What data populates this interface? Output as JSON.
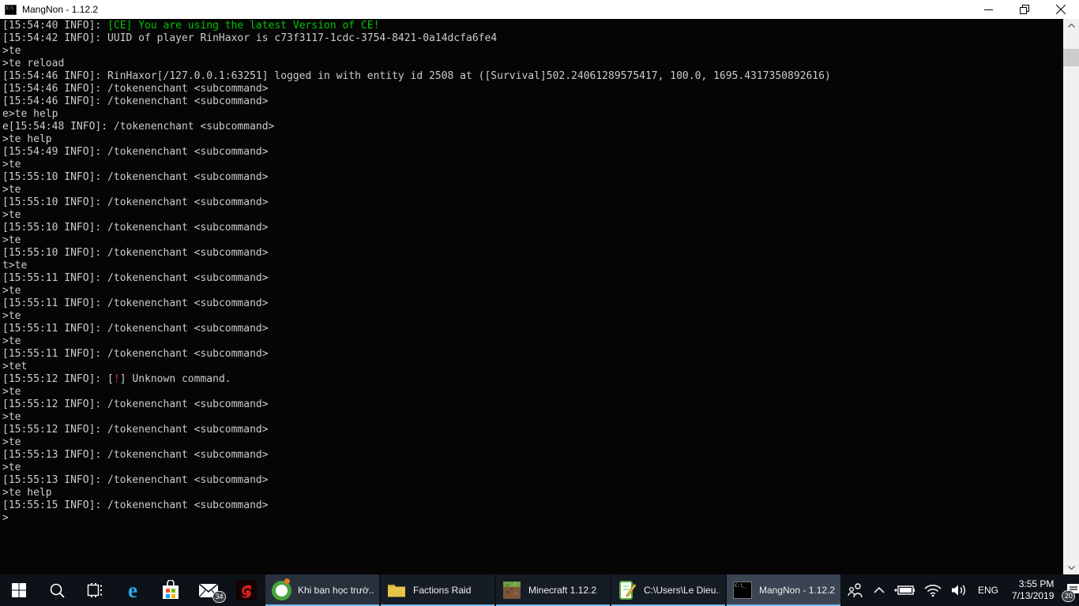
{
  "window": {
    "title": "MangNon - 1.12.2"
  },
  "console": {
    "lines": [
      {
        "segments": [
          {
            "t": "[15:54:40 INFO]: ",
            "c": "default"
          },
          {
            "t": "[CE] You are using the latest Version of CE!",
            "c": "green"
          }
        ]
      },
      {
        "segments": [
          {
            "t": "[15:54:42 INFO]: UUID of player RinHaxor is c73f3117-1cdc-3754-8421-0a14dcfa6fe4",
            "c": "default"
          }
        ]
      },
      {
        "segments": [
          {
            "t": ">te",
            "c": "default"
          }
        ]
      },
      {
        "segments": [
          {
            "t": ">te reload",
            "c": "default"
          }
        ]
      },
      {
        "segments": [
          {
            "t": "[15:54:46 INFO]: RinHaxor[/127.0.0.1:63251] logged in with entity id 2508 at ([Survival]502.24061289575417, 100.0, 1695.4317350892616)",
            "c": "default"
          }
        ]
      },
      {
        "segments": [
          {
            "t": "[15:54:46 INFO]: /tokenenchant <subcommand>",
            "c": "default"
          }
        ]
      },
      {
        "segments": [
          {
            "t": "[15:54:46 INFO]: /tokenenchant <subcommand>",
            "c": "default"
          }
        ]
      },
      {
        "segments": [
          {
            "t": "e>te help",
            "c": "default"
          }
        ]
      },
      {
        "segments": [
          {
            "t": "e[15:54:48 INFO]: /tokenenchant <subcommand>",
            "c": "default"
          }
        ]
      },
      {
        "segments": [
          {
            "t": ">te help",
            "c": "default"
          }
        ]
      },
      {
        "segments": [
          {
            "t": "[15:54:49 INFO]: /tokenenchant <subcommand>",
            "c": "default"
          }
        ]
      },
      {
        "segments": [
          {
            "t": ">te",
            "c": "default"
          }
        ]
      },
      {
        "segments": [
          {
            "t": "[15:55:10 INFO]: /tokenenchant <subcommand>",
            "c": "default"
          }
        ]
      },
      {
        "segments": [
          {
            "t": ">te",
            "c": "default"
          }
        ]
      },
      {
        "segments": [
          {
            "t": "[15:55:10 INFO]: /tokenenchant <subcommand>",
            "c": "default"
          }
        ]
      },
      {
        "segments": [
          {
            "t": ">te",
            "c": "default"
          }
        ]
      },
      {
        "segments": [
          {
            "t": "[15:55:10 INFO]: /tokenenchant <subcommand>",
            "c": "default"
          }
        ]
      },
      {
        "segments": [
          {
            "t": ">te",
            "c": "default"
          }
        ]
      },
      {
        "segments": [
          {
            "t": "[15:55:10 INFO]: /tokenenchant <subcommand>",
            "c": "default"
          }
        ]
      },
      {
        "segments": [
          {
            "t": "t>te",
            "c": "default"
          }
        ]
      },
      {
        "segments": [
          {
            "t": "[15:55:11 INFO]: /tokenenchant <subcommand>",
            "c": "default"
          }
        ]
      },
      {
        "segments": [
          {
            "t": ">te",
            "c": "default"
          }
        ]
      },
      {
        "segments": [
          {
            "t": "[15:55:11 INFO]: /tokenenchant <subcommand>",
            "c": "default"
          }
        ]
      },
      {
        "segments": [
          {
            "t": ">te",
            "c": "default"
          }
        ]
      },
      {
        "segments": [
          {
            "t": "[15:55:11 INFO]: /tokenenchant <subcommand>",
            "c": "default"
          }
        ]
      },
      {
        "segments": [
          {
            "t": ">te",
            "c": "default"
          }
        ]
      },
      {
        "segments": [
          {
            "t": "[15:55:11 INFO]: /tokenenchant <subcommand>",
            "c": "default"
          }
        ]
      },
      {
        "segments": [
          {
            "t": ">tet",
            "c": "default"
          }
        ]
      },
      {
        "segments": [
          {
            "t": "[15:55:12 INFO]: [",
            "c": "default"
          },
          {
            "t": "!",
            "c": "red"
          },
          {
            "t": "] Unknown command.",
            "c": "default"
          }
        ]
      },
      {
        "segments": [
          {
            "t": ">te",
            "c": "default"
          }
        ]
      },
      {
        "segments": [
          {
            "t": "[15:55:12 INFO]: /tokenenchant <subcommand>",
            "c": "default"
          }
        ]
      },
      {
        "segments": [
          {
            "t": ">te",
            "c": "default"
          }
        ]
      },
      {
        "segments": [
          {
            "t": "[15:55:12 INFO]: /tokenenchant <subcommand>",
            "c": "default"
          }
        ]
      },
      {
        "segments": [
          {
            "t": ">te",
            "c": "default"
          }
        ]
      },
      {
        "segments": [
          {
            "t": "[15:55:13 INFO]: /tokenenchant <subcommand>",
            "c": "default"
          }
        ]
      },
      {
        "segments": [
          {
            "t": ">te",
            "c": "default"
          }
        ]
      },
      {
        "segments": [
          {
            "t": "[15:55:13 INFO]: /tokenenchant <subcommand>",
            "c": "default"
          }
        ]
      },
      {
        "segments": [
          {
            "t": ">te help",
            "c": "default"
          }
        ]
      },
      {
        "segments": [
          {
            "t": "[15:55:15 INFO]: /tokenenchant <subcommand>",
            "c": "default"
          }
        ]
      },
      {
        "segments": [
          {
            "t": ">",
            "c": "default"
          }
        ]
      }
    ],
    "colors": {
      "default": "#cccccc",
      "green": "#00c400",
      "red": "#e6372e",
      "background": "#050505"
    }
  },
  "taskbar": {
    "mail_badge": "34",
    "apps": [
      {
        "label": "Khi bạn học trườ...",
        "icon": "coccoc",
        "active": false
      },
      {
        "label": "Factions Raid",
        "icon": "folder",
        "active": false
      },
      {
        "label": "Minecraft 1.12.2",
        "icon": "minecraft",
        "active": false
      },
      {
        "label": "C:\\Users\\Le Dieu...",
        "icon": "notepadpp",
        "active": false
      },
      {
        "label": "MangNon - 1.12.2",
        "icon": "console",
        "active": true
      }
    ],
    "tray": {
      "language": "ENG",
      "time": "3:55 PM",
      "date": "7/13/2019",
      "notification_badge": "20"
    },
    "accent_underline": "#76b8ea"
  }
}
